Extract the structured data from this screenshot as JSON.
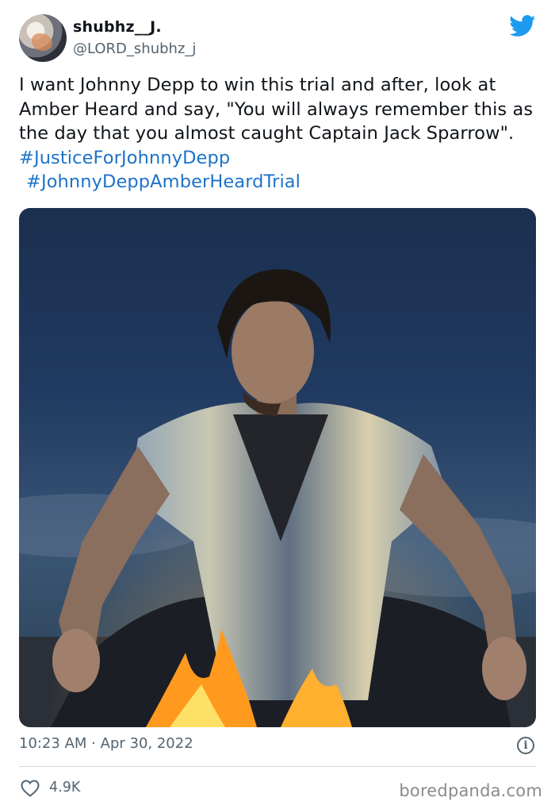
{
  "user": {
    "display_name": "shubhz__J.",
    "handle": "@LORD_shubhz_j",
    "avatar_icon": "profile-avatar"
  },
  "platform_icon": "twitter-bird-icon",
  "brand_color": "#1d9bf0",
  "tweet": {
    "text": "I want Johnny Depp to win this trial and after, look at Amber Heard and say, \"You will always remember this as the day that you almost caught Captain Jack Sparrow\". ",
    "hashtag_1": "#JusticeForJohnnyDepp",
    "hashtag_2": "#JohnnyDeppAmberHeardTrial",
    "hashtag_color": "#1d72c9"
  },
  "photo": {
    "icon": "photo-man-by-campfire"
  },
  "meta": {
    "time": "10:23 AM",
    "separator": " · ",
    "date": "Apr 30, 2022",
    "info_glyph": "i"
  },
  "engagement": {
    "likes": "4.9K",
    "like_icon": "heart-icon"
  },
  "watermark": "boredpanda.com"
}
